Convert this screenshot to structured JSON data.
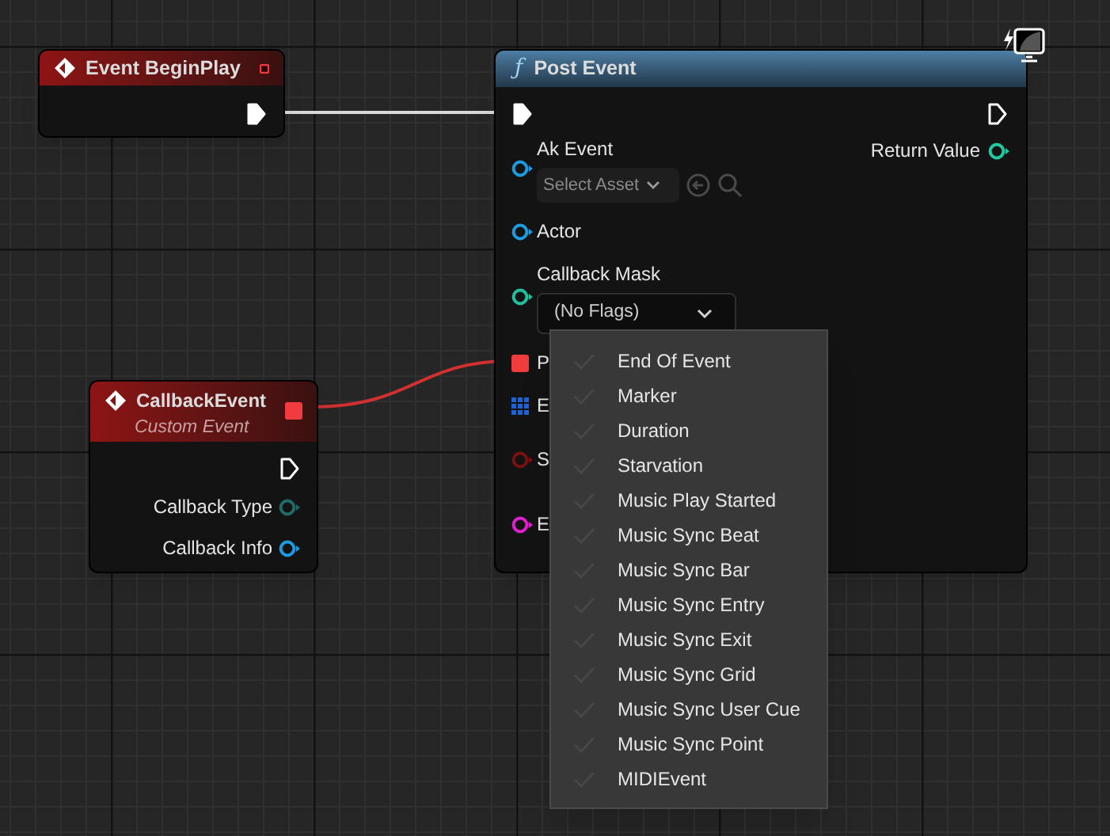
{
  "begin_play_node": {
    "title": "Event BeginPlay"
  },
  "post_event_node": {
    "icon": "ƒ",
    "title": "Post Event",
    "inputs": [
      {
        "label": "Ak Event",
        "kind": "circle",
        "color": "#1e9ae0",
        "asset_picker": "Select Asset"
      },
      {
        "label": "Actor",
        "kind": "circle",
        "color": "#1e9ae0"
      },
      {
        "label": "Callback Mask",
        "kind": "circle",
        "color": "#20c0a0",
        "dropdown": "(No Flags)"
      },
      {
        "label": "P",
        "kind": "square",
        "color": "#f03c3c"
      },
      {
        "label": "E",
        "kind": "grid",
        "color": "#1d63d6"
      },
      {
        "label": "S",
        "kind": "circle",
        "color": "#7a1010"
      },
      {
        "label": "E",
        "kind": "circle",
        "color": "#e020d0"
      }
    ],
    "outputs": [
      {
        "label": "Return Value",
        "kind": "circle",
        "color": "#22c8a0"
      }
    ]
  },
  "callback_node": {
    "title": "CallbackEvent",
    "subtitle": "Custom Event",
    "outputs": [
      {
        "label": "Callback Type",
        "kind": "circle",
        "color": "#1f6b66"
      },
      {
        "label": "Callback Info",
        "kind": "circle",
        "color": "#1e9ae0"
      }
    ]
  },
  "flags_menu": {
    "items": [
      {
        "label": "End Of Event",
        "checked": false
      },
      {
        "label": "Marker",
        "checked": false
      },
      {
        "label": "Duration",
        "checked": false
      },
      {
        "label": "Starvation",
        "checked": false
      },
      {
        "label": "Music Play Started",
        "checked": false
      },
      {
        "label": "Music Sync Beat",
        "checked": false
      },
      {
        "label": "Music Sync Bar",
        "checked": false
      },
      {
        "label": "Music Sync Entry",
        "checked": false
      },
      {
        "label": "Music Sync Exit",
        "checked": false
      },
      {
        "label": "Music Sync Grid",
        "checked": false
      },
      {
        "label": "Music Sync User Cue",
        "checked": false
      },
      {
        "label": "Music Sync Point",
        "checked": false
      },
      {
        "label": "MIDIEvent",
        "checked": false
      }
    ]
  }
}
